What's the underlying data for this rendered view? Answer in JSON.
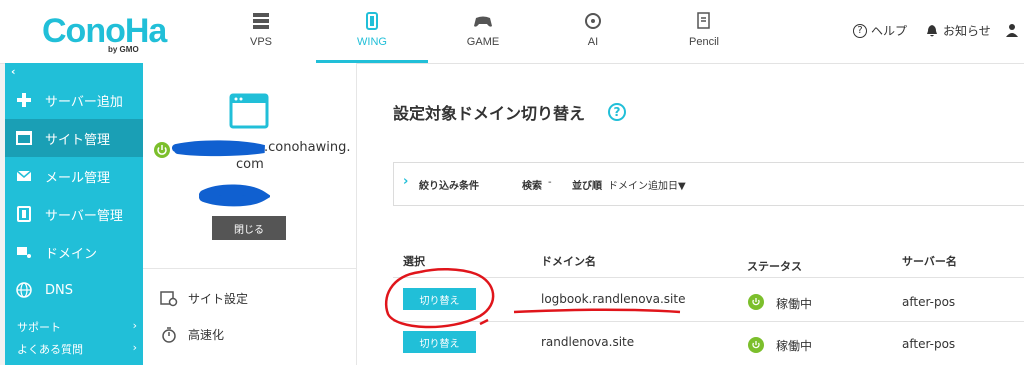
{
  "brand": {
    "logo_text": "ConoHa",
    "logo_sub": "by GMO",
    "color": "#21bfd8"
  },
  "nav": {
    "tabs": [
      {
        "label": "VPS",
        "icon": "server-icon"
      },
      {
        "label": "WING",
        "icon": "wing-icon",
        "active": true
      },
      {
        "label": "GAME",
        "icon": "gamepad-icon"
      },
      {
        "label": "AI",
        "icon": "ai-chip-icon"
      },
      {
        "label": "Pencil",
        "icon": "pencil-icon"
      }
    ],
    "help": "ヘルプ",
    "notifications": "お知らせ"
  },
  "sidebar": {
    "collapse_icon": "chevron-left-icon",
    "items": [
      {
        "label": "サーバー追加",
        "icon": "plus-icon"
      },
      {
        "label": "サイト管理",
        "icon": "window-icon",
        "active": true
      },
      {
        "label": "メール管理",
        "icon": "mail-icon"
      },
      {
        "label": "サーバー管理",
        "icon": "server-box-icon"
      },
      {
        "label": "ドメイン",
        "icon": "domain-icon"
      },
      {
        "label": "DNS",
        "icon": "globe-icon"
      }
    ],
    "sub": [
      {
        "label": "サポート"
      },
      {
        "label": "よくある質問"
      }
    ]
  },
  "site_panel": {
    "domain_suffix": ".conohawing.",
    "domain_suffix2": "com",
    "close_label": "閉じる",
    "menu": [
      {
        "label": "サイト設定",
        "icon": "site-settings-icon"
      },
      {
        "label": "高速化",
        "icon": "stopwatch-icon"
      }
    ]
  },
  "main": {
    "title": "設定対象ドメイン切り替え",
    "filter": {
      "label": "絞り込み条件",
      "search_label": "検索",
      "search_value": "-",
      "sort_label": "並び順",
      "sort_value": "ドメイン追加日▼"
    },
    "table": {
      "headers": [
        "選択",
        "ドメイン名",
        "ステータス",
        "サーバー名"
      ],
      "rows": [
        {
          "button": "切り替え",
          "domain": "logbook.randlenova.site",
          "status": "稼働中",
          "server": "after-pos"
        },
        {
          "button": "切り替え",
          "domain": "randlenova.site",
          "status": "稼働中",
          "server": "after-pos"
        }
      ]
    }
  },
  "colors": {
    "accent": "#21bfd8",
    "sidebar_active": "#1a9fb5",
    "status_ok": "#7cbf2c",
    "annotation_red": "#e0151b",
    "redaction_blue": "#1060d0"
  }
}
